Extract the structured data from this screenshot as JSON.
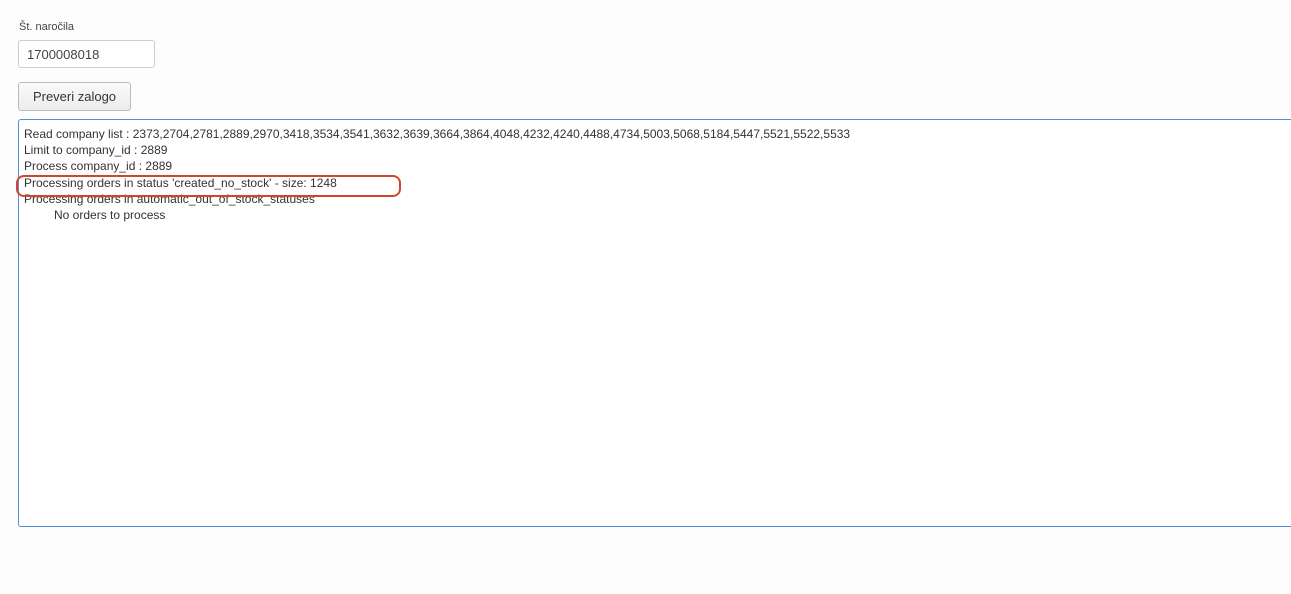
{
  "order_field": {
    "label": "Št. naročila",
    "value": "1700008018"
  },
  "check_button": {
    "label": "Preveri zalogo"
  },
  "output": {
    "lines": [
      "Read company list : 2373,2704,2781,2889,2970,3418,3534,3541,3632,3639,3664,3864,4048,4232,4240,4488,4734,5003,5068,5184,5447,5521,5522,5533",
      "Limit to company_id : 2889",
      "Process company_id : 2889",
      "Processing orders in status 'created_no_stock' - size: 1248",
      "Processing orders in automatic_out_of_stock_statuses",
      "No orders to process"
    ]
  },
  "annotation": {
    "color": "#d1452f"
  },
  "colors": {
    "focus_border": "#4a90d9"
  }
}
